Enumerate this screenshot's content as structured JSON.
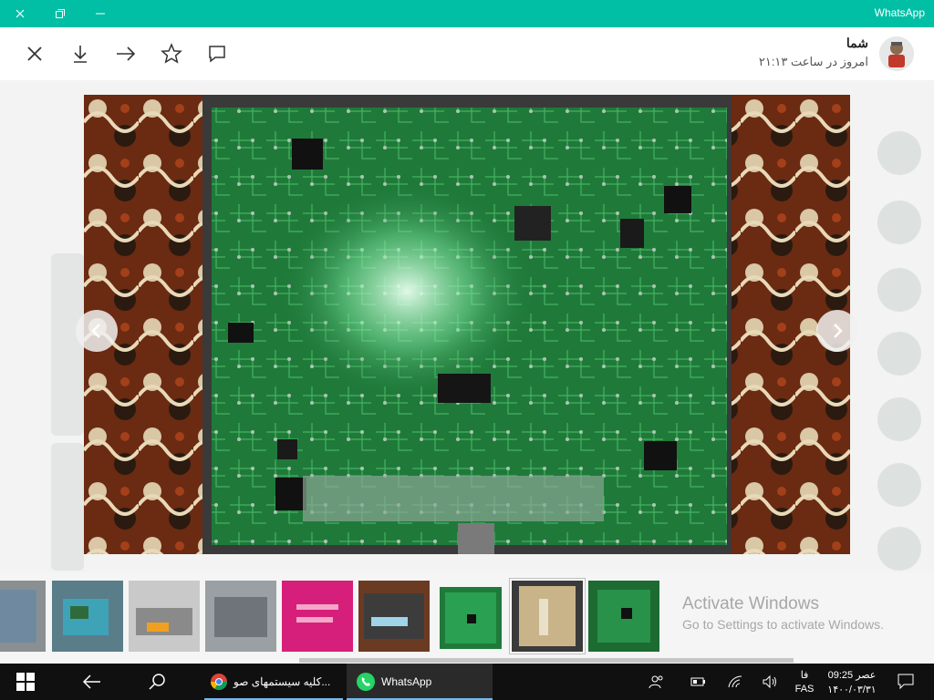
{
  "window": {
    "title": "WhatsApp"
  },
  "viewer": {
    "sender_name": "شما",
    "sender_time": "امروز در ساعت ۲۱:۱۳",
    "actions": [
      "close-icon",
      "download-icon",
      "forward-icon",
      "star-icon",
      "reply-icon"
    ]
  },
  "watermark": {
    "line1": "Activate Windows",
    "line2": "Go to Settings to activate Windows."
  },
  "taskbar": {
    "chrome_label": "کلیه سیستمهای صو...",
    "whatsapp_label": "WhatsApp",
    "time": "09:25 عصر",
    "date": "۱۴۰۰/۰۳/۳۱",
    "lang_top": "فا",
    "lang_bottom": "FAS"
  },
  "colors": {
    "accent": "#00bfa5",
    "taskbar": "#101010",
    "pcb": "#1f7a3a"
  }
}
